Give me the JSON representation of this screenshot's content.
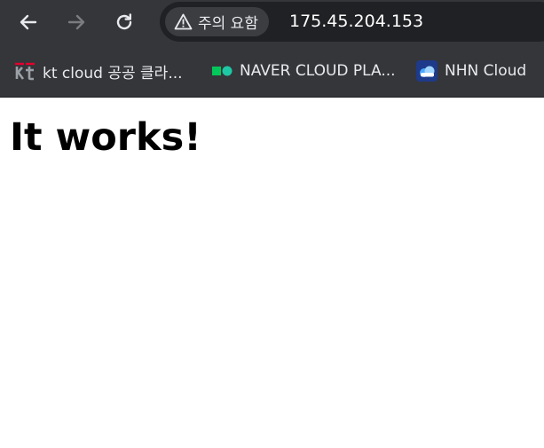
{
  "browser": {
    "security_chip_label": "주의 요함",
    "url": "175.45.204.153"
  },
  "bookmarks": [
    {
      "label": "kt cloud 공공 클라...",
      "icon": "kt-logo-icon"
    },
    {
      "label": "NAVER CLOUD PLA...",
      "icon": "naver-cloud-icon"
    },
    {
      "label": "NHN Cloud",
      "icon": "nhn-cloud-icon"
    }
  ],
  "page": {
    "heading": "It works!"
  },
  "colors": {
    "toolbar_bg": "#35363a",
    "omnibox_bg": "#202124",
    "naver_green": "#03c75a",
    "nhn_blue": "#1e5fd8"
  }
}
